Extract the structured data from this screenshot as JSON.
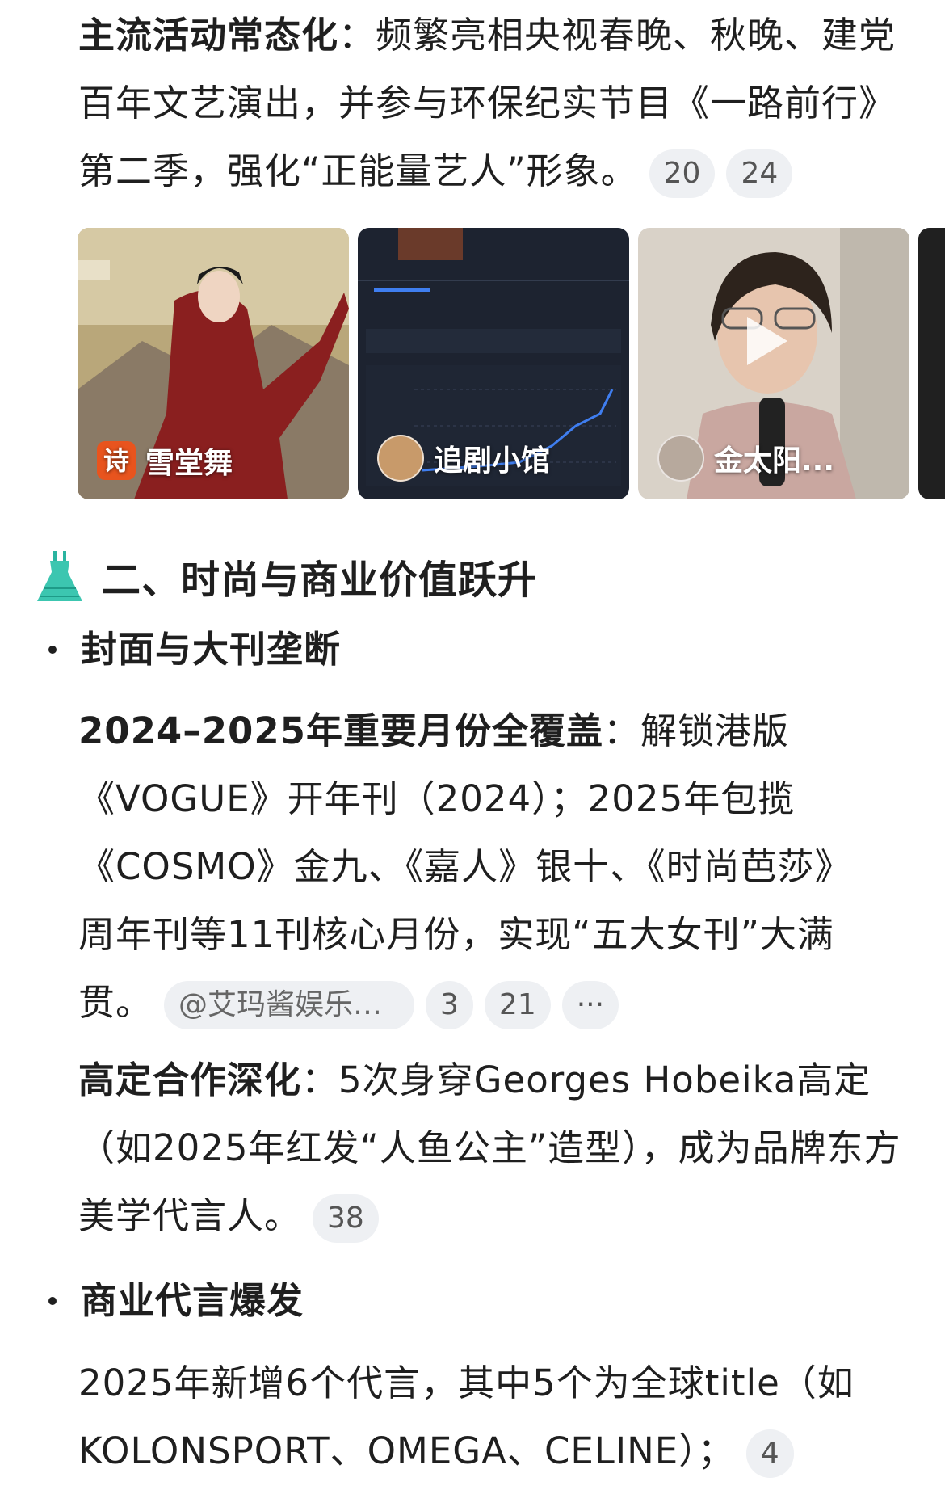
{
  "para1": {
    "bold": "主流活动常态化",
    "text": "：频繁亮相央视春晚、秋晚、建党百年文艺演出，并参与环保纪实节目《一路前行》第二季，强化“正能量艺人”形象。",
    "cites": [
      "20",
      "24"
    ]
  },
  "thumbs": [
    {
      "label": "雪堂舞",
      "icon": "poem-badge-icon"
    },
    {
      "label": "追剧小馆",
      "icon": "food-avatar-icon"
    },
    {
      "label": "金太阳...",
      "icon": "person-avatar-icon"
    }
  ],
  "section2": {
    "emoji": "dress-emoji-icon",
    "title": "二、时尚与商业价值跃升"
  },
  "bullet1": "封面与大刊垄断",
  "para2": {
    "bold": "2024–2025年重要月份全覆盖",
    "text": "：解锁港版《VOGUE》开年刊（2024）；2025年包揽《COSMO》金九、《嘉人》银十、《时尚芭莎》周年刊等11刊核心月份，实现“五大女刊”大满贯。",
    "tag": "@艾玛酱娱乐手...",
    "cites": [
      "3",
      "21"
    ],
    "more": "···"
  },
  "para3": {
    "bold": "高定合作深化",
    "text": "：5次身穿Georges Hobeika高定（如2025年红发“人鱼公主”造型），成为品牌东方美学代言人。",
    "cites": [
      "38"
    ]
  },
  "bullet2": "商业代言爆发",
  "para4": {
    "text": "2025年新增6个代言，其中5个为全球title（如KOLONSPORT、OMEGA、CELINE）；",
    "cites": [
      "4"
    ]
  }
}
